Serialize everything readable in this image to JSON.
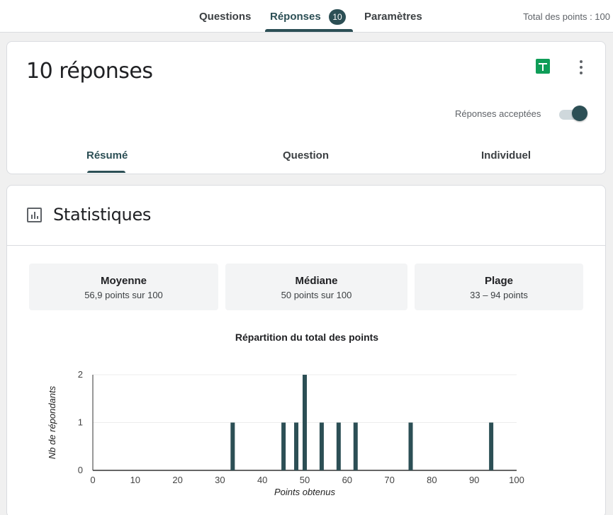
{
  "nav": {
    "tabs": [
      {
        "label": "Questions"
      },
      {
        "label": "Réponses",
        "badge": "10"
      },
      {
        "label": "Paramètres"
      }
    ],
    "total_points": "Total des points : 100"
  },
  "summary": {
    "title": "10 réponses",
    "accept_label": "Réponses acceptées",
    "accepting": true,
    "tabs": [
      "Résumé",
      "Question",
      "Individuel"
    ]
  },
  "stats": {
    "title": "Statistiques",
    "boxes": [
      {
        "label": "Moyenne",
        "value": "56,9 points sur 100"
      },
      {
        "label": "Médiane",
        "value": "50 points sur 100"
      },
      {
        "label": "Plage",
        "value": "33 – 94 points"
      }
    ]
  },
  "colors": {
    "accent": "#2c4f55",
    "sheets": "#0f9d58"
  },
  "chart_data": {
    "type": "bar",
    "title": "Répartition du total des points",
    "xlabel": "Points obtenus",
    "ylabel": "Nb de répondants",
    "xlim": [
      0,
      100
    ],
    "ylim": [
      0,
      2
    ],
    "x_ticks": [
      "0",
      "10",
      "20",
      "30",
      "40",
      "50",
      "60",
      "70",
      "80",
      "90",
      "100"
    ],
    "y_ticks": [
      "0",
      "1",
      "2"
    ],
    "x": [
      33,
      45,
      48,
      50,
      54,
      58,
      62,
      75,
      94
    ],
    "values": [
      1,
      1,
      1,
      2,
      1,
      1,
      1,
      1,
      1
    ],
    "color": "#2c4f55",
    "grid": true
  }
}
